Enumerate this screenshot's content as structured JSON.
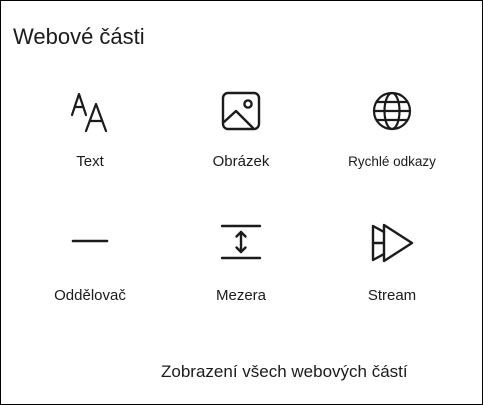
{
  "panel": {
    "title": "Webové části",
    "see_all_link": "Zobrazení všech webových částí"
  },
  "tiles": [
    {
      "label": "Text",
      "icon": "text-icon"
    },
    {
      "label": "Obrázek",
      "icon": "image-icon"
    },
    {
      "label": "Rychlé odkazy",
      "icon": "globe-icon"
    },
    {
      "label": "Oddělovač",
      "icon": "divider-icon"
    },
    {
      "label": "Mezera",
      "icon": "spacer-icon"
    },
    {
      "label": "Stream",
      "icon": "stream-icon"
    }
  ],
  "colors": {
    "text": "#1b1b1b",
    "border": "#000000",
    "background": "#ffffff"
  }
}
